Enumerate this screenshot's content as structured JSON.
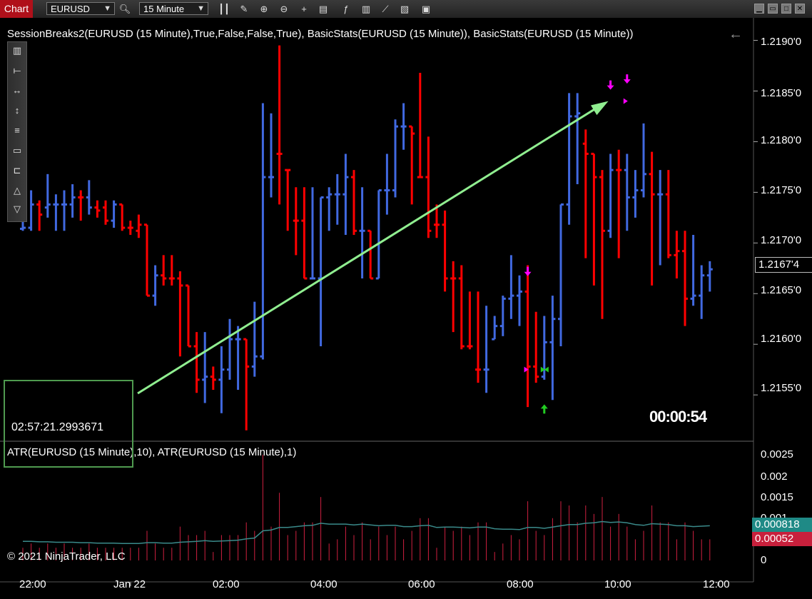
{
  "toolbar": {
    "tab_label": "Chart",
    "instrument": "EURUSD",
    "interval": "15 Minute",
    "icons": [
      "search-icon",
      "bar-type-icon",
      "draw-tool-icon",
      "zoom-in-icon",
      "zoom-out-icon",
      "crosshair-icon",
      "properties-icon",
      "indicators-icon",
      "strategies-icon",
      "chart-trader-icon",
      "templates-icon",
      "share-icon"
    ],
    "window_buttons": [
      "minimize",
      "restore",
      "maximize",
      "close"
    ]
  },
  "chart": {
    "indicator_title": "SessionBreaks2(EURUSD (15 Minute),True,False,False,True), BasicStats(EURUSD (15 Minute)), BasicStats(EURUSD (15 Minute))",
    "atr_title": "ATR(EURUSD (15 Minute),10), ATR(EURUSD (15 Minute),1)",
    "copyright": "© 2021 NinjaTrader, LLC",
    "bar_timer": "00:00:54",
    "time_readout": "02:57:21.2993671",
    "last_price": "1.2167'4",
    "atr10_value": "0.000818",
    "atr1_value": "0.00052",
    "up_color": "#4169e1",
    "down_color": "#ff0000",
    "arrow_color": "#90ee90",
    "atr10_color": "#3a8a8a",
    "atr1_color": "#d02040",
    "price_ticks": [
      "1.2190'0",
      "1.2185'0",
      "1.2180'0",
      "1.2175'0",
      "1.2170'0",
      "1.2165'0",
      "1.2160'0",
      "1.2155'0"
    ],
    "atr_ticks": [
      "0.0025",
      "0.002",
      "0.0015",
      "0.001",
      "0"
    ],
    "time_ticks": [
      "22:00",
      "Jan 22",
      "02:00",
      "04:00",
      "06:00",
      "08:00",
      "10:00",
      "12:00"
    ]
  },
  "chart_data": {
    "type": "ohlc",
    "price_ylim": [
      1.21505,
      1.21918
    ],
    "atr_ylim": [
      0,
      0.0026
    ],
    "bars": [
      {
        "o": 1.21714,
        "h": 1.21722,
        "l": 1.21712,
        "c": 1.21715
      },
      {
        "o": 1.21715,
        "h": 1.21752,
        "l": 1.21712,
        "c": 1.21738
      },
      {
        "o": 1.21738,
        "h": 1.21742,
        "l": 1.21712,
        "c": 1.21728
      },
      {
        "o": 1.21735,
        "h": 1.21768,
        "l": 1.21725,
        "c": 1.21738
      },
      {
        "o": 1.21738,
        "h": 1.21748,
        "l": 1.21712,
        "c": 1.21738
      },
      {
        "o": 1.21738,
        "h": 1.21752,
        "l": 1.21712,
        "c": 1.21738
      },
      {
        "o": 1.21738,
        "h": 1.21758,
        "l": 1.21725,
        "c": 1.21745
      },
      {
        "o": 1.21745,
        "h": 1.21752,
        "l": 1.21722,
        "c": 1.21745
      },
      {
        "o": 1.21745,
        "h": 1.21762,
        "l": 1.21728,
        "c": 1.21735
      },
      {
        "o": 1.21735,
        "h": 1.21742,
        "l": 1.21725,
        "c": 1.21732
      },
      {
        "o": 1.21735,
        "h": 1.21742,
        "l": 1.21718,
        "c": 1.21722
      },
      {
        "o": 1.21722,
        "h": 1.21742,
        "l": 1.21715,
        "c": 1.21738
      },
      {
        "o": 1.21738,
        "h": 1.21732,
        "l": 1.21712,
        "c": 1.21715
      },
      {
        "o": 1.21715,
        "h": 1.21722,
        "l": 1.21708,
        "c": 1.21715
      },
      {
        "o": 1.21712,
        "h": 1.21728,
        "l": 1.21705,
        "c": 1.21718
      },
      {
        "o": 1.21718,
        "h": 1.21718,
        "l": 1.21648,
        "c": 1.21648
      },
      {
        "o": 1.21648,
        "h": 1.21678,
        "l": 1.21638,
        "c": 1.21668
      },
      {
        "o": 1.21668,
        "h": 1.21688,
        "l": 1.21658,
        "c": 1.21665
      },
      {
        "o": 1.21665,
        "h": 1.21688,
        "l": 1.21658,
        "c": 1.21665
      },
      {
        "o": 1.21665,
        "h": 1.21672,
        "l": 1.21588,
        "c": 1.21658
      },
      {
        "o": 1.21658,
        "h": 1.21658,
        "l": 1.21598,
        "c": 1.21598
      },
      {
        "o": 1.21598,
        "h": 1.21612,
        "l": 1.21552,
        "c": 1.21565
      },
      {
        "o": 1.21565,
        "h": 1.21612,
        "l": 1.21542,
        "c": 1.21568
      },
      {
        "o": 1.21568,
        "h": 1.21578,
        "l": 1.21555,
        "c": 1.21565
      },
      {
        "o": 1.21565,
        "h": 1.21598,
        "l": 1.21532,
        "c": 1.21575
      },
      {
        "o": 1.21575,
        "h": 1.21625,
        "l": 1.21565,
        "c": 1.21605
      },
      {
        "o": 1.21605,
        "h": 1.21618,
        "l": 1.21555,
        "c": 1.21605
      },
      {
        "o": 1.21605,
        "h": 1.21605,
        "l": 1.21515,
        "c": 1.21578
      },
      {
        "o": 1.21578,
        "h": 1.21642,
        "l": 1.21568,
        "c": 1.21588
      },
      {
        "o": 1.21588,
        "h": 1.21838,
        "l": 1.21585,
        "c": 1.21765
      },
      {
        "o": 1.21765,
        "h": 1.21828,
        "l": 1.21745,
        "c": 1.21765
      },
      {
        "o": 1.21788,
        "h": 1.21895,
        "l": 1.21738,
        "c": 1.21788
      },
      {
        "o": 1.21772,
        "h": 1.21768,
        "l": 1.21712,
        "c": 1.21772
      },
      {
        "o": 1.21722,
        "h": 1.21755,
        "l": 1.21688,
        "c": 1.21722
      },
      {
        "o": 1.21722,
        "h": 1.21755,
        "l": 1.21665,
        "c": 1.21665
      },
      {
        "o": 1.21665,
        "h": 1.21755,
        "l": 1.21665,
        "c": 1.21665
      },
      {
        "o": 1.21665,
        "h": 1.21745,
        "l": 1.21598,
        "c": 1.21745
      },
      {
        "o": 1.21745,
        "h": 1.21755,
        "l": 1.21712,
        "c": 1.21748
      },
      {
        "o": 1.21748,
        "h": 1.21768,
        "l": 1.21718,
        "c": 1.21748
      },
      {
        "o": 1.21748,
        "h": 1.21788,
        "l": 1.21708,
        "c": 1.21765
      },
      {
        "o": 1.21765,
        "h": 1.21772,
        "l": 1.21708,
        "c": 1.21712
      },
      {
        "o": 1.21712,
        "h": 1.21755,
        "l": 1.21665,
        "c": 1.21712
      },
      {
        "o": 1.21712,
        "h": 1.21712,
        "l": 1.21665,
        "c": 1.21665
      },
      {
        "o": 1.21665,
        "h": 1.21742,
        "l": 1.21692,
        "c": 1.21752
      },
      {
        "o": 1.21752,
        "h": 1.21788,
        "l": 1.21728,
        "c": 1.21752
      },
      {
        "o": 1.21752,
        "h": 1.21822,
        "l": 1.21745,
        "c": 1.21815
      },
      {
        "o": 1.21815,
        "h": 1.21838,
        "l": 1.21792,
        "c": 1.21815
      },
      {
        "o": 1.21815,
        "h": 1.21808,
        "l": 1.21738,
        "c": 1.21808
      },
      {
        "o": 1.21765,
        "h": 1.21868,
        "l": 1.21765,
        "c": 1.21765
      },
      {
        "o": 1.21765,
        "h": 1.21805,
        "l": 1.21705,
        "c": 1.21712
      },
      {
        "o": 1.21718,
        "h": 1.21738,
        "l": 1.21705,
        "c": 1.21718
      },
      {
        "o": 1.21718,
        "h": 1.21732,
        "l": 1.21652,
        "c": 1.21665
      },
      {
        "o": 1.21665,
        "h": 1.21682,
        "l": 1.21612,
        "c": 1.21665
      },
      {
        "o": 1.21665,
        "h": 1.21678,
        "l": 1.21595,
        "c": 1.21598
      },
      {
        "o": 1.21598,
        "h": 1.21652,
        "l": 1.21595,
        "c": 1.21598
      },
      {
        "o": 1.21575,
        "h": 1.21652,
        "l": 1.21562,
        "c": 1.21575
      },
      {
        "o": 1.21575,
        "h": 1.21638,
        "l": 1.21552,
        "c": 1.21575
      },
      {
        "o": 1.21605,
        "h": 1.21628,
        "l": 1.21605,
        "c": 1.21618
      },
      {
        "o": 1.21618,
        "h": 1.21648,
        "l": 1.21608,
        "c": 1.21645
      },
      {
        "o": 1.21645,
        "h": 1.21688,
        "l": 1.21625,
        "c": 1.21648
      },
      {
        "o": 1.21648,
        "h": 1.21668,
        "l": 1.21618,
        "c": 1.21652
      },
      {
        "o": 1.21652,
        "h": 1.21678,
        "l": 1.21538,
        "c": 1.21578
      },
      {
        "o": 1.21578,
        "h": 1.21632,
        "l": 1.21562,
        "c": 1.21568
      },
      {
        "o": 1.21568,
        "h": 1.21628,
        "l": 1.21565,
        "c": 1.21602
      },
      {
        "o": 1.21602,
        "h": 1.21648,
        "l": 1.21545,
        "c": 1.21625
      },
      {
        "o": 1.21625,
        "h": 1.21738,
        "l": 1.21598,
        "c": 1.21738
      },
      {
        "o": 1.21738,
        "h": 1.21848,
        "l": 1.21718,
        "c": 1.21825
      },
      {
        "o": 1.21825,
        "h": 1.21848,
        "l": 1.21758,
        "c": 1.21828
      },
      {
        "o": 1.21798,
        "h": 1.21812,
        "l": 1.21685,
        "c": 1.21788
      },
      {
        "o": 1.21788,
        "h": 1.21765,
        "l": 1.21658,
        "c": 1.21765
      },
      {
        "o": 1.21765,
        "h": 1.21772,
        "l": 1.21625,
        "c": 1.21712
      },
      {
        "o": 1.21712,
        "h": 1.21788,
        "l": 1.21705,
        "c": 1.21772
      },
      {
        "o": 1.21772,
        "h": 1.21792,
        "l": 1.21685,
        "c": 1.21772
      },
      {
        "o": 1.21772,
        "h": 1.21788,
        "l": 1.21712,
        "c": 1.21745
      },
      {
        "o": 1.21745,
        "h": 1.21772,
        "l": 1.21725,
        "c": 1.21752
      },
      {
        "o": 1.21752,
        "h": 1.21818,
        "l": 1.21745,
        "c": 1.21768
      },
      {
        "o": 1.21768,
        "h": 1.2179,
        "l": 1.21658,
        "c": 1.21748
      },
      {
        "o": 1.21748,
        "h": 1.21772,
        "l": 1.21678,
        "c": 1.21748
      },
      {
        "o": 1.21748,
        "h": 1.21772,
        "l": 1.21685,
        "c": 1.21688
      },
      {
        "o": 1.21688,
        "h": 1.21712,
        "l": 1.21665,
        "c": 1.21692
      },
      {
        "o": 1.21692,
        "h": 1.21712,
        "l": 1.21618,
        "c": 1.21645
      },
      {
        "o": 1.21645,
        "h": 1.21708,
        "l": 1.21638,
        "c": 1.21648
      },
      {
        "o": 1.21648,
        "h": 1.21678,
        "l": 1.21625,
        "c": 1.21668
      },
      {
        "o": 1.21668,
        "h": 1.21682,
        "l": 1.21652,
        "c": 1.21674
      }
    ],
    "up_flags": [
      1,
      1,
      0,
      1,
      1,
      1,
      1,
      0,
      1,
      0,
      0,
      1,
      0,
      0,
      0,
      0,
      1,
      0,
      0,
      0,
      0,
      0,
      1,
      0,
      1,
      1,
      1,
      0,
      1,
      1,
      1,
      0,
      0,
      0,
      0,
      1,
      1,
      1,
      1,
      1,
      0,
      1,
      0,
      1,
      1,
      1,
      1,
      0,
      0,
      0,
      0,
      0,
      0,
      0,
      0,
      0,
      1,
      1,
      1,
      1,
      1,
      0,
      0,
      1,
      1,
      1,
      1,
      1,
      0,
      0,
      0,
      1,
      0,
      1,
      1,
      1,
      0,
      1,
      0,
      0,
      0,
      1,
      1,
      1
    ],
    "atr1": [
      0.0003,
      0.0004,
      0.0003,
      0.0004,
      0.0003,
      0.0004,
      0.0003,
      0.0003,
      0.0004,
      0.0003,
      0.0003,
      0.0003,
      0.0003,
      0.0003,
      0.0003,
      0.0007,
      0.0004,
      0.0003,
      0.0003,
      0.0008,
      0.0006,
      0.0006,
      0.0007,
      0.0002,
      0.0006,
      0.0006,
      0.0006,
      0.0009,
      0.0007,
      0.0025,
      0.0008,
      0.0016,
      0.0006,
      0.0007,
      0.0009,
      0.0009,
      0.0015,
      0.0004,
      0.0005,
      0.0008,
      0.0006,
      0.0009,
      0.0005,
      0.0008,
      0.0006,
      0.0008,
      0.0005,
      0.0007,
      0.001,
      0.001,
      0.0003,
      0.0008,
      0.0007,
      0.0008,
      0.0006,
      0.0009,
      0.0009,
      0.0002,
      0.0004,
      0.0006,
      0.0005,
      0.0014,
      0.0007,
      0.0006,
      0.001,
      0.0014,
      0.0013,
      0.0009,
      0.0013,
      0.0011,
      0.0015,
      0.0008,
      0.0011,
      0.0008,
      0.0005,
      0.0007,
      0.0013,
      0.0009,
      0.0009,
      0.0005,
      0.0009,
      0.0007,
      0.0005,
      0.0005
    ],
    "atr10": [
      0.00045,
      0.00045,
      0.00044,
      0.00044,
      0.00043,
      0.00043,
      0.00043,
      0.00042,
      0.00042,
      0.00041,
      0.00041,
      0.00041,
      0.0004,
      0.0004,
      0.0004,
      0.00042,
      0.00042,
      0.00041,
      0.00041,
      0.00043,
      0.00044,
      0.00045,
      0.00047,
      0.00045,
      0.00046,
      0.00047,
      0.00048,
      0.00051,
      0.00053,
      0.0007,
      0.00072,
      0.00078,
      0.00078,
      0.0008,
      0.00082,
      0.00083,
      0.00088,
      0.00086,
      0.00086,
      0.00086,
      0.00084,
      0.00086,
      0.00084,
      0.00082,
      0.00083,
      0.00083,
      0.0008,
      0.0008,
      0.00082,
      0.00083,
      0.00078,
      0.00079,
      0.00079,
      0.00078,
      0.00077,
      0.00079,
      0.00079,
      0.00075,
      0.00074,
      0.00074,
      0.00073,
      0.00078,
      0.00078,
      0.00076,
      0.00079,
      0.00082,
      0.00085,
      0.00085,
      0.00088,
      0.00089,
      0.00092,
      0.0009,
      0.00091,
      0.00089,
      0.00085,
      0.00083,
      0.00087,
      0.00086,
      0.00085,
      0.00082,
      0.00082,
      0.0008,
      0.00081,
      0.00082
    ],
    "trend_line": {
      "from_bar": 12,
      "from_price": 1.21545,
      "to_bar": 71,
      "to_price": 1.2184
    },
    "markers": [
      {
        "bar": 61,
        "price": 1.21668,
        "type": "down-arrow",
        "color": "#ff00ff"
      },
      {
        "bar": 61,
        "price": 1.21575,
        "type": "right-tri",
        "color": "#ff00ff"
      },
      {
        "bar": 63,
        "price": 1.21575,
        "type": "right-tri",
        "color": "#22cc22"
      },
      {
        "bar": 63,
        "price": 1.21575,
        "type": "left-tri",
        "color": "#22cc22"
      },
      {
        "bar": 63,
        "price": 1.2154,
        "type": "up-arrow",
        "color": "#22cc22"
      },
      {
        "bar": 71,
        "price": 1.21852,
        "type": "down-arrow",
        "color": "#ff00ff"
      },
      {
        "bar": 73,
        "price": 1.21858,
        "type": "down-arrow",
        "color": "#ff00ff"
      },
      {
        "bar": 73,
        "price": 1.2184,
        "type": "right-tri",
        "color": "#ff00ff"
      }
    ]
  }
}
